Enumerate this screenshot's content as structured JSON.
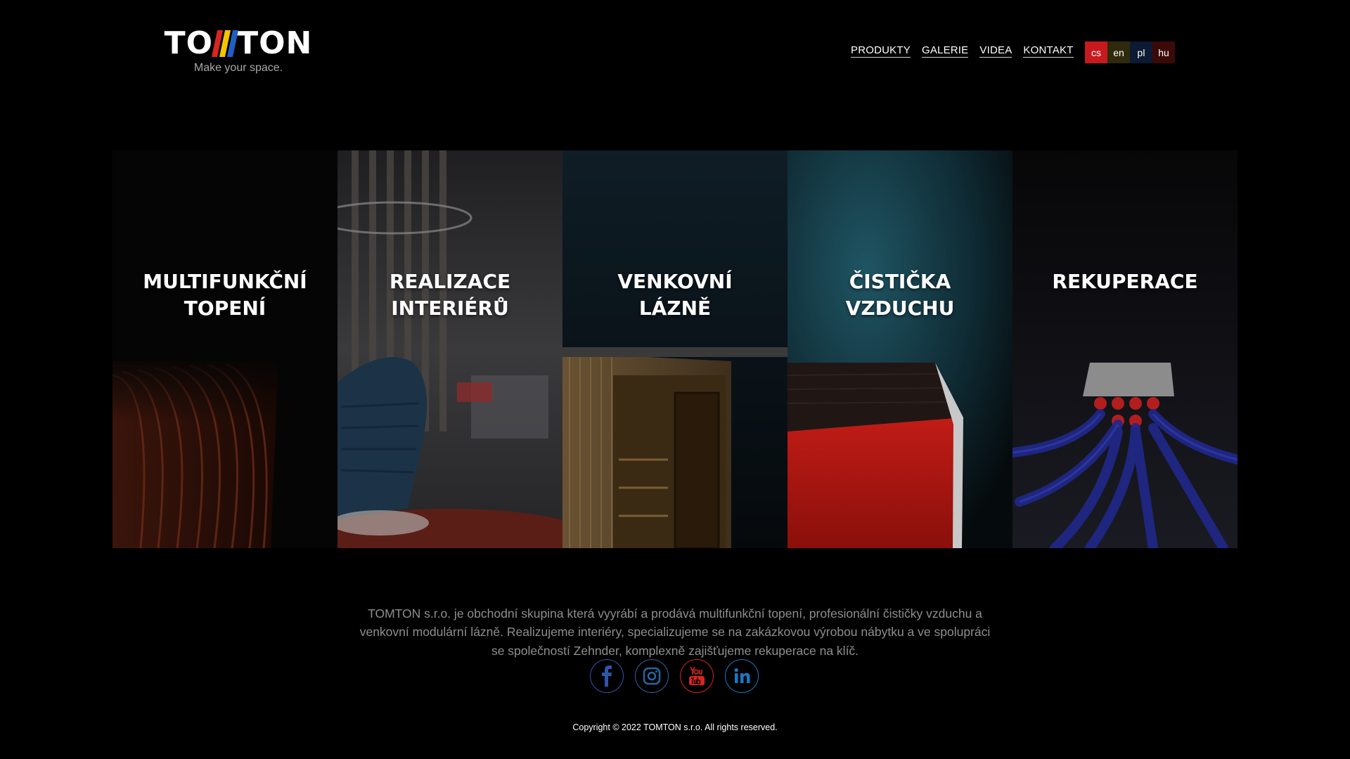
{
  "brand": {
    "name_left": "TO",
    "name_right": "TON",
    "tagline": "Make your space.",
    "bar_colors": [
      "#d7261f",
      "#f2c500",
      "#1f5fc4"
    ]
  },
  "nav": {
    "items": [
      {
        "label": "PRODUKTY"
      },
      {
        "label": "GALERIE"
      },
      {
        "label": "VIDEA"
      },
      {
        "label": "KONTAKT"
      }
    ]
  },
  "languages": [
    {
      "code": "cs",
      "color": "#c8191f",
      "active": true
    },
    {
      "code": "en",
      "color": "#2e2a0b",
      "active": false
    },
    {
      "code": "pl",
      "color": "#0d1a33",
      "active": false
    },
    {
      "code": "hu",
      "color": "#3c0909",
      "active": false
    }
  ],
  "categories": [
    {
      "title": "MULTIFUNKČNÍ\nTOPENÍ",
      "icon": "heater-image"
    },
    {
      "title": "REALIZACE\nINTERIÉRŮ",
      "icon": "interior-image"
    },
    {
      "title": "VENKOVNÍ\nLÁZNĚ",
      "icon": "sauna-image"
    },
    {
      "title": "ČISTIČKA\nVZDUCHU",
      "icon": "air-purifier-image"
    },
    {
      "title": "REKUPERACE",
      "icon": "ventilation-image"
    }
  ],
  "about": {
    "text": "TOMTON s.r.o. je obchodní skupina která vyyrábí a prodává multifunkční topení, profesionální čističky vzduchu a venkovní modulární lázně. Realizujeme interiéry, specializujeme se na zakázkovou výrobou nábytku a ve spolupráci se společností Zehnder, komplexně zajišťujeme rekuperace na klíč."
  },
  "social": [
    {
      "icon": "facebook-icon",
      "color": "#2e55a8"
    },
    {
      "icon": "instagram-icon",
      "color": "#2b64a0"
    },
    {
      "icon": "youtube-icon",
      "color": "#d7261f"
    },
    {
      "icon": "linkedin-icon",
      "color": "#1a78c2"
    }
  ],
  "copyright": "Copyright © 2022 TOMTON s.r.o. All rights reserved."
}
